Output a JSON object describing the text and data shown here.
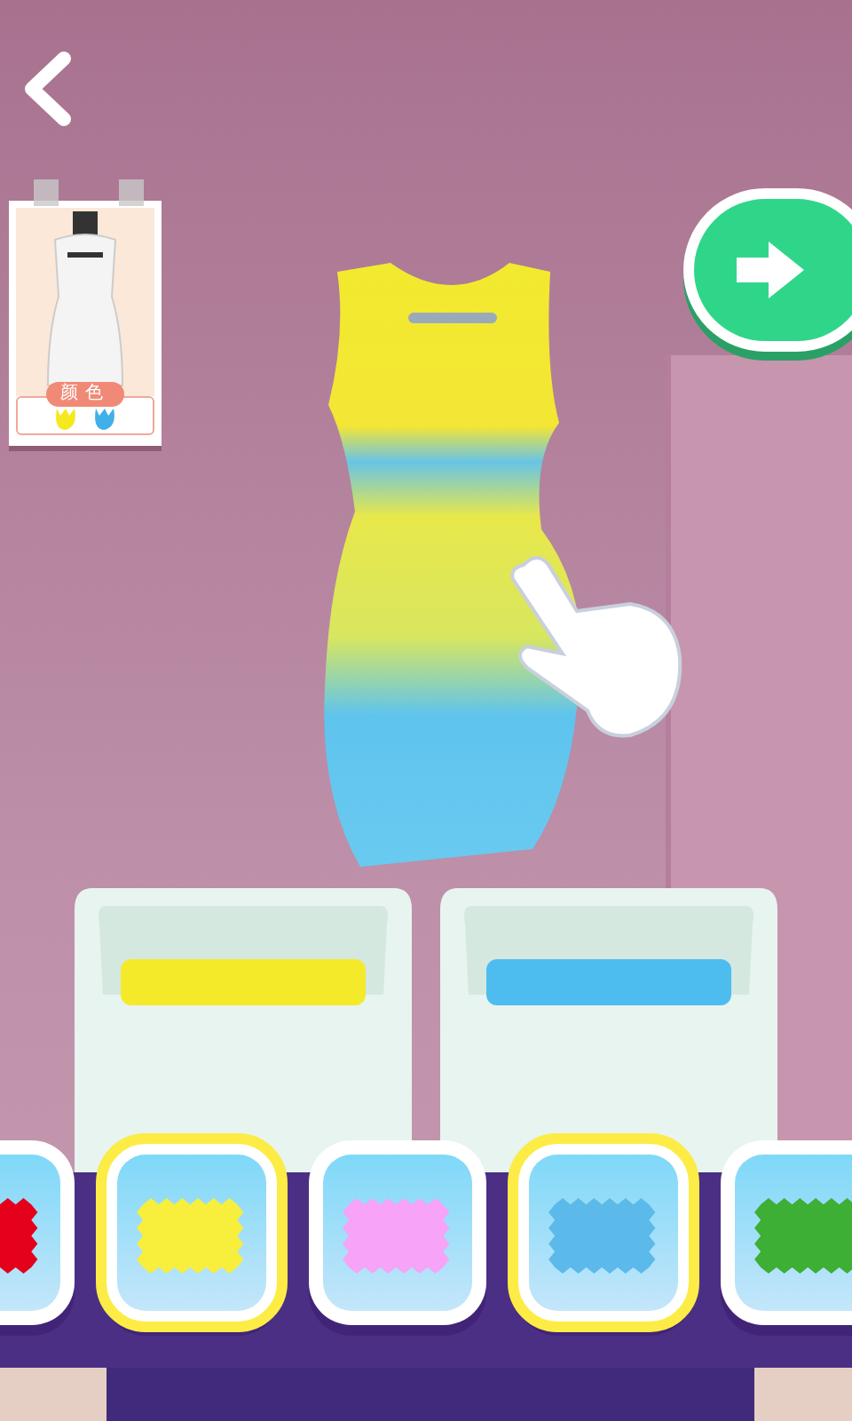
{
  "reference_card": {
    "label": "颜色",
    "target_colors": [
      {
        "color": "#f5e81e"
      },
      {
        "color": "#3fb0ea"
      }
    ]
  },
  "swatches": [
    {
      "color": "#e5001c",
      "selected": false
    },
    {
      "color": "#f8ee3c",
      "selected": true
    },
    {
      "color": "#f7a3f7",
      "selected": false
    },
    {
      "color": "#5bbaea",
      "selected": true
    },
    {
      "color": "#3caf34",
      "selected": false
    }
  ],
  "tubs": [
    {
      "color": "#f5ea2a"
    },
    {
      "color": "#4dbdf0"
    }
  ]
}
